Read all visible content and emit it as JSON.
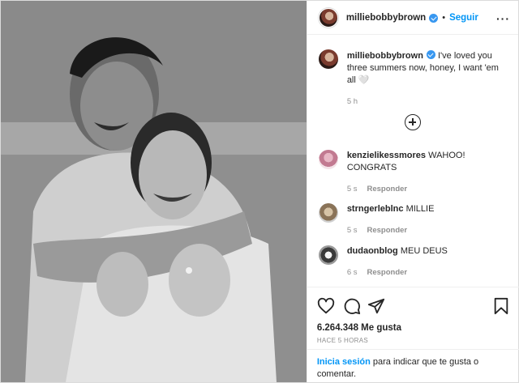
{
  "post": {
    "author": {
      "username": "milliebobbybrown",
      "follow_label": "Seguir",
      "dot": "•"
    },
    "caption": {
      "username": "milliebobbybrown",
      "text": "I've loved you three summers now, honey, I want 'em all 🤍",
      "time": "5 h"
    },
    "comments": [
      {
        "username": "kenzielikessmores",
        "text": "WAHOO! CONGRATS",
        "time": "5 s",
        "reply_label": "Responder"
      },
      {
        "username": "strngerleblnc",
        "text": "MILLIE",
        "time": "5 s",
        "reply_label": "Responder"
      },
      {
        "username": "dudaonblog",
        "text": "MEU DEUS",
        "time": "6 s",
        "reply_label": "Responder"
      }
    ],
    "likes": "6.264.348 Me gusta",
    "posted_ago": "HACE 5 HORAS",
    "login_prompt": {
      "link": "Inicia sesión",
      "text": "para indicar que te gusta o comentar."
    }
  },
  "icons": [
    "more-icon",
    "load-more-comments-icon",
    "heart-icon",
    "comment-icon",
    "share-icon",
    "bookmark-icon",
    "verified-icon"
  ],
  "colors": {
    "link_blue": "#0095f6",
    "verified_blue": "#3897f0",
    "muted": "#8e8e8e",
    "text": "#262626"
  }
}
